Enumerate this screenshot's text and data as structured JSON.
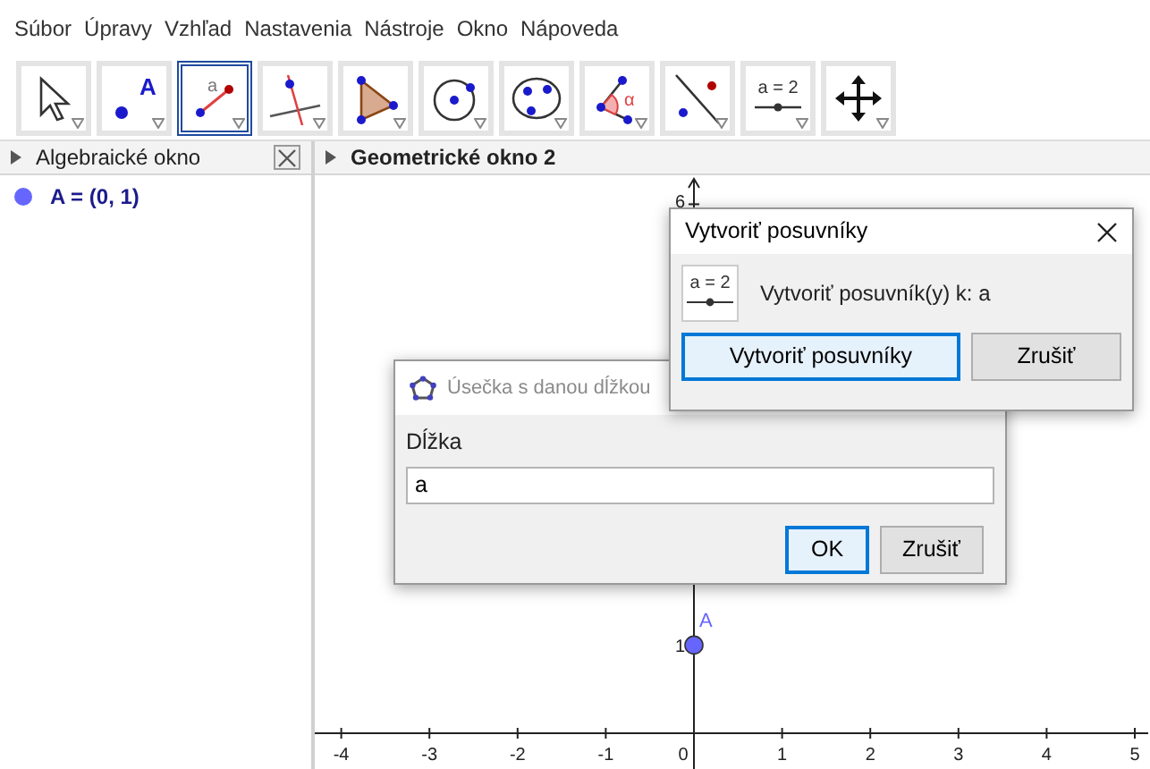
{
  "menu": [
    "Súbor",
    "Úpravy",
    "Vzhľad",
    "Nastavenia",
    "Nástroje",
    "Okno",
    "Nápoveda"
  ],
  "toolbar": {
    "tools": [
      {
        "selected": false
      },
      {
        "glyph": "A",
        "selected": false
      },
      {
        "glyph": "a",
        "selected": true
      },
      {
        "selected": false
      },
      {
        "selected": false
      },
      {
        "selected": false
      },
      {
        "selected": false
      },
      {
        "glyph": "α",
        "selected": false
      },
      {
        "selected": false
      },
      {
        "glyph": "a = 2",
        "selected": false
      },
      {
        "selected": false
      }
    ]
  },
  "algebra_view": {
    "title": "Algebraické okno",
    "items": [
      {
        "text": "A = (0, 1)",
        "color": "#6666ff"
      }
    ]
  },
  "graphics_view": {
    "title": "Geometrické okno 2",
    "x_axis_labels": [
      "-4",
      "-3",
      "-2",
      "-1",
      "0",
      "1",
      "2",
      "3",
      "4",
      "5"
    ],
    "y_axis_labels": [
      "6",
      "1"
    ],
    "points": [
      {
        "label": "A",
        "color": "#6666ff"
      }
    ]
  },
  "dialogs": [
    {
      "kind": "input",
      "title": "Úsečka s danou dĺžkou",
      "label": "Dĺžka",
      "value": "a",
      "buttons": [
        {
          "label": "OK",
          "focused": true
        },
        {
          "label": "Zrušiť",
          "focused": false
        }
      ]
    },
    {
      "kind": "confirm",
      "title": "Vytvoriť posuvníky",
      "icon_text": "a = 2",
      "message": "Vytvoriť posuvník(y) k: a",
      "buttons": [
        {
          "label": "Vytvoriť posuvníky",
          "focused": true
        },
        {
          "label": "Zrušiť",
          "focused": false
        }
      ]
    }
  ]
}
